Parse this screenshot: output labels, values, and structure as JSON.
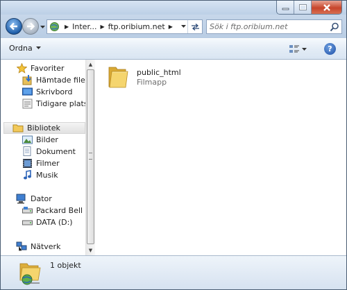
{
  "window": {
    "minimize_icon": "minimize-icon",
    "maximize_icon": "maximize-icon",
    "close_icon": "close-icon"
  },
  "address_bar": {
    "crumbs": [
      "Inter...",
      "ftp.oribium.net"
    ]
  },
  "search": {
    "placeholder": "Sök i ftp.oribium.net"
  },
  "toolbar": {
    "organize_label": "Ordna",
    "help_label": "?"
  },
  "nav_pane": {
    "favorites": {
      "label": "Favoriter",
      "items": [
        {
          "label": "Hämtade filer",
          "icon": "downloads-icon"
        },
        {
          "label": "Skrivbord",
          "icon": "desktop-icon"
        },
        {
          "label": "Tidigare platser",
          "icon": "recent-places-icon"
        }
      ]
    },
    "libraries": {
      "label": "Bibliotek",
      "items": [
        {
          "label": "Bilder",
          "icon": "pictures-icon"
        },
        {
          "label": "Dokument",
          "icon": "documents-icon"
        },
        {
          "label": "Filmer",
          "icon": "videos-icon"
        },
        {
          "label": "Musik",
          "icon": "music-icon"
        }
      ]
    },
    "computer": {
      "label": "Dator",
      "items": [
        {
          "label": "Packard Bell (C:)",
          "icon": "drive-c-icon"
        },
        {
          "label": "DATA (D:)",
          "icon": "drive-d-icon"
        }
      ]
    },
    "network": {
      "label": "Nätverk"
    }
  },
  "files": [
    {
      "name": "public_html",
      "type": "Filmapp",
      "icon": "folder-icon"
    }
  ],
  "details": {
    "count": "1 objekt"
  },
  "colors": {
    "chrome": "#c5d5e8",
    "folder": "#f2c95a",
    "close_button": "#c7452b"
  }
}
